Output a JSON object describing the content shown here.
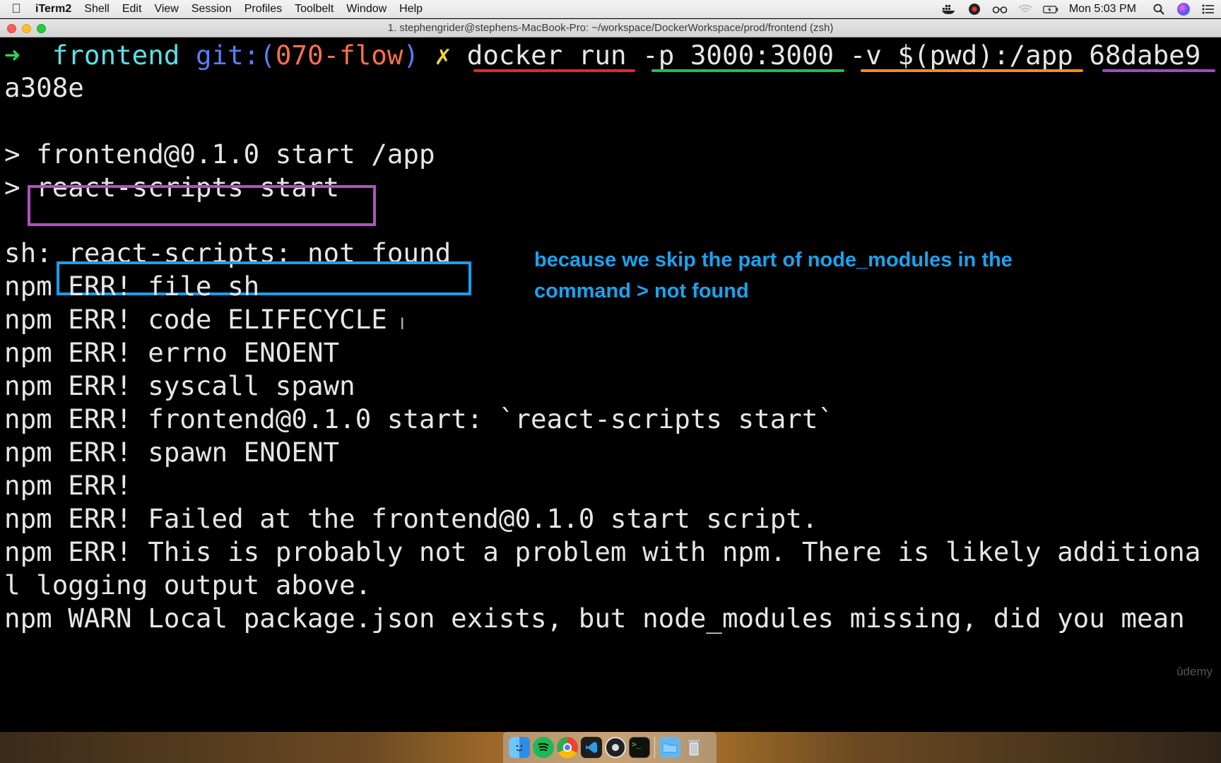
{
  "menubar": {
    "app_name": "iTerm2",
    "menus": [
      "Shell",
      "Edit",
      "View",
      "Session",
      "Profiles",
      "Toolbelt",
      "Window",
      "Help"
    ],
    "status_icons": [
      "docker-icon",
      "creative-cloud-icon",
      "glasses-icon",
      "wifi-icon",
      "battery-icon"
    ],
    "clock": "Mon 5:03 PM"
  },
  "window": {
    "title": "1. stephengrider@stephens-MacBook-Pro: ~/workspace/DockerWorkspace/prod/frontend (zsh)"
  },
  "terminal": {
    "prompt": {
      "arrow": "➜",
      "dir": "frontend",
      "git_prefix": "git:(",
      "branch": "070-flow",
      "git_suffix": ")",
      "dirty": "✗"
    },
    "command": {
      "part1": "docker run",
      "part2": "-p 3000:3000",
      "part3": "-v $(pwd):/app",
      "part4": "68dabe9"
    },
    "command_wrap": "a308e",
    "lines": [
      "> frontend@0.1.0 start /app",
      "> ",
      "react-scripts start",
      "sh: ",
      "react-scripts: not found",
      "npm ERR! file sh",
      "npm ERR! code ELIFECYCLE",
      "npm ERR! errno ENOENT",
      "npm ERR! syscall spawn",
      "npm ERR! frontend@0.1.0 start: `react-scripts start`",
      "npm ERR! spawn ENOENT",
      "npm ERR!",
      "npm ERR! Failed at the frontend@0.1.0 start script.",
      "npm ERR! This is probably not a problem with npm. There is likely additiona",
      "l logging output above.",
      "npm WARN Local package.json exists, but node_modules missing, did you mean"
    ],
    "annotation": "because we skip the part of node_modules in the command > not found",
    "watermark": "ûdemy"
  },
  "colors": {
    "underline_1": "#e8252a",
    "underline_2": "#1fbf4a",
    "underline_3": "#f5891f",
    "underline_4": "#a548c8",
    "box_react_scripts": "#b34fc4",
    "box_not_found": "#1a9fe8",
    "annotation": "#1aa3ee"
  },
  "dock": {
    "icons": [
      "finder-icon",
      "spotify-icon",
      "chrome-icon",
      "vscode-icon",
      "obs-icon",
      "terminal-icon",
      "folder-icon",
      "trash-icon"
    ]
  }
}
